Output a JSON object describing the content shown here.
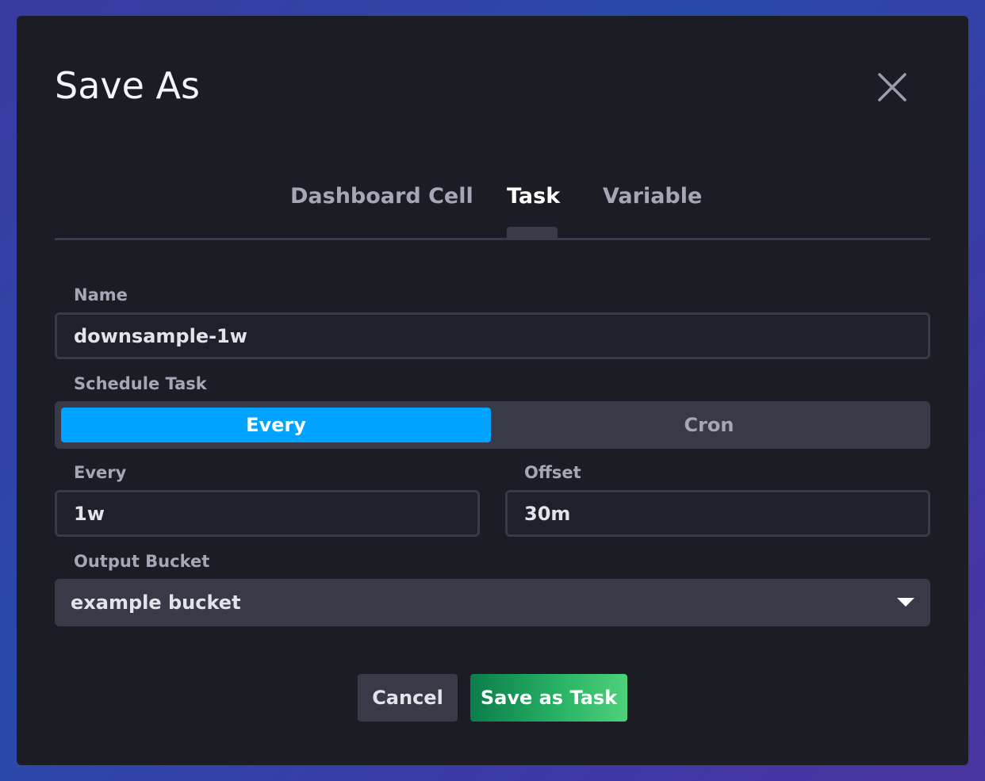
{
  "dialog": {
    "title": "Save As",
    "close_icon": "close-icon"
  },
  "tabs": [
    {
      "label": "Dashboard Cell",
      "active": false
    },
    {
      "label": "Task",
      "active": true
    },
    {
      "label": "Variable",
      "active": false
    }
  ],
  "form": {
    "name": {
      "label": "Name",
      "value": "downsample-1w"
    },
    "schedule": {
      "label": "Schedule Task",
      "options": [
        "Every",
        "Cron"
      ],
      "selected": "Every"
    },
    "every": {
      "label": "Every",
      "value": "1w"
    },
    "offset": {
      "label": "Offset",
      "value": "30m"
    },
    "output_bucket": {
      "label": "Output Bucket",
      "value": "example bucket",
      "icon": "caret-down-icon"
    }
  },
  "footer": {
    "cancel_label": "Cancel",
    "save_label": "Save as Task"
  },
  "colors": {
    "accent": "#00a3ff",
    "save_green": "#22b35e",
    "dialog_bg": "#1b1c24"
  }
}
